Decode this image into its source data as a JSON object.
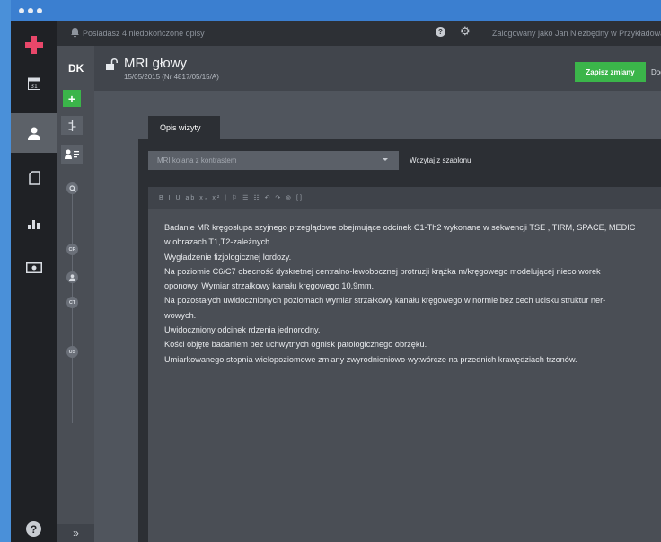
{
  "topbar": {
    "notice": "Posiadasz 4 niedokończone opisy",
    "user_text": "Zalogowany jako Jan Niezbędny w Przykładowa"
  },
  "sidebar": {
    "initials": "DK",
    "rail_badges": [
      "CR",
      "CT",
      "US"
    ]
  },
  "header": {
    "title": "MRI głowy",
    "subtitle": "15/05/2015 (Nr 4817/05/15/A)",
    "save_label": "Zapisz zmiany",
    "next_label": "Dod"
  },
  "main": {
    "tab_label": "Opis wizyty",
    "template_select_value": "MRI kolana z kontrastem",
    "load_template_label": "Wczytaj z szablonu",
    "toolbar_glyphs": "B I U ab x₂ x² | ⚐ ☰ ☷ ↶ ↷ ⊚ []",
    "text_lines": [
      "Badanie MR kręgosłupa szyjnego przeglądowe obejmujące odcinek C1-Th2 wykonane w sekwencji TSE , TIRM, SPACE, MEDIC",
      "w obrazach T1,T2-zależnych .",
      "Wygładzenie fizjologicznej lordozy.",
      "Na poziomie C6/C7 obecność dyskretnej  centralno-lewobocznej protruzji krążka m/kręgowego modelującej nieco worek",
      "oponowy. Wymiar strzałkowy kanału kręgowego 10,9mm.",
      "Na pozostałych uwidocznionych poziomach wymiar strzałkowy kanału kręgowego w normie bez cech  ucisku struktur ner-",
      "wowych.",
      "Uwidoczniony odcinek rdzenia jednorodny.",
      "Kości objęte badaniem bez uchwytnych ognisk patologicznego obrzęku.",
      "Umiarkowanego stopnia wielopoziomowe zmiany zwyrodnieniowo-wytwórcze na przednich krawędziach trzonów."
    ]
  },
  "colors": {
    "accent_green": "#3bb54a",
    "brand_pink": "#e8476a",
    "titlebar_blue": "#3b7fd0"
  }
}
